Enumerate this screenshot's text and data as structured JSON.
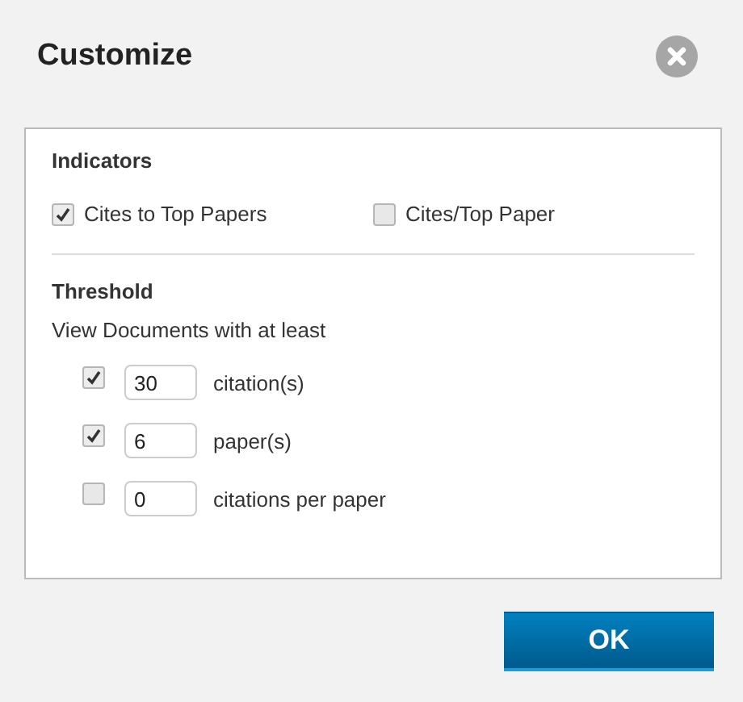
{
  "dialog": {
    "title": "Customize"
  },
  "indicators": {
    "heading": "Indicators",
    "options": [
      {
        "label": "Cites to Top Papers",
        "checked": true
      },
      {
        "label": "Cites/Top Paper",
        "checked": false
      }
    ]
  },
  "threshold": {
    "heading": "Threshold",
    "intro": "View Documents with at least",
    "rows": [
      {
        "checked": true,
        "value": "30",
        "unit": "citation(s)"
      },
      {
        "checked": true,
        "value": "6",
        "unit": "paper(s)"
      },
      {
        "checked": false,
        "value": "0",
        "unit": "citations per paper"
      }
    ]
  },
  "buttons": [
    "OK"
  ]
}
